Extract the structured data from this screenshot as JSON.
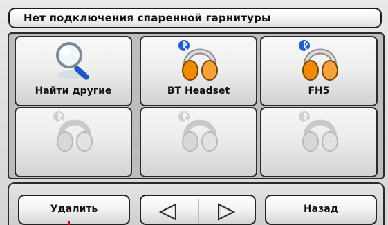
{
  "header": {
    "title": "Нет подключения спаренной гарнитуры"
  },
  "tiles": [
    {
      "label": "Найти другие",
      "icon": "magnifier-search-icon",
      "enabled": true
    },
    {
      "label": "BT Headset",
      "icon": "bluetooth-headset-icon",
      "enabled": true
    },
    {
      "label": "FH5",
      "icon": "bluetooth-headset-icon",
      "enabled": true
    },
    {
      "label": "",
      "icon": "bluetooth-headset-disabled-icon",
      "enabled": false
    },
    {
      "label": "",
      "icon": "bluetooth-headset-disabled-icon",
      "enabled": false
    },
    {
      "label": "",
      "icon": "bluetooth-headset-disabled-icon",
      "enabled": false
    }
  ],
  "toolbar": {
    "delete_label": "Удалить",
    "back_label": "Назад",
    "prev_icon": "arrow-left-icon",
    "next_icon": "arrow-right-icon"
  },
  "colors": {
    "headset_orange": "#f28a00",
    "bluetooth_blue": "#1f5fd6",
    "disabled_gray": "#b8b8b8"
  }
}
